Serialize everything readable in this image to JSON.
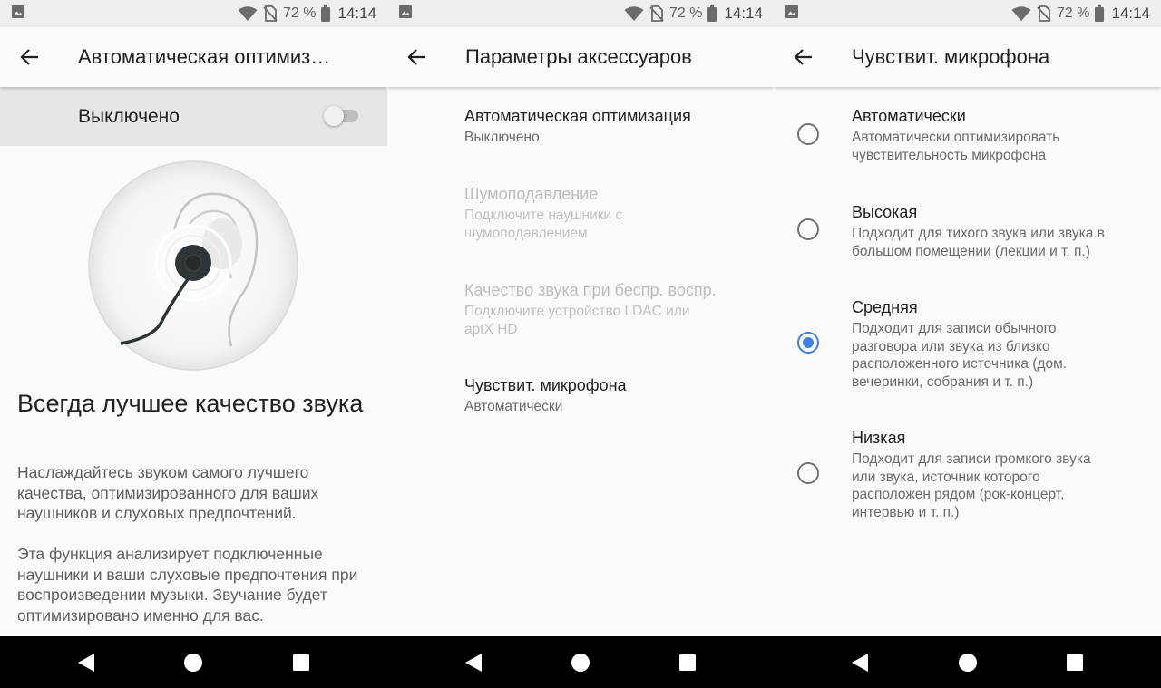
{
  "statusbar": {
    "battery": "72 %",
    "time": "14:14"
  },
  "screen1": {
    "title": "Автоматическая оптимиз…",
    "toggle_label": "Выключено",
    "toggle_on": false,
    "headline": "Всегда лучшее качество звука",
    "para1": "Наслаждайтесь звуком самого лучшего качества, оптимизированного для ваших наушников и слуховых предпочтений.",
    "para2": "Эта функция анализирует подключенные наушники и ваши слуховые предпочтения при воспроизведении музыки. Звучание будет оптимизировано именно для вас."
  },
  "screen2": {
    "title": "Параметры аксессуаров",
    "items": [
      {
        "title": "Автоматическая оптимизация",
        "summary": "Выключено",
        "enabled": true
      },
      {
        "title": "Шумоподавление",
        "summary": "Подключите наушники с шумоподавлением",
        "enabled": false
      },
      {
        "title": "Качество звука при беспр. воспр.",
        "summary": "Подключите устройство LDAC или aptX HD",
        "enabled": false
      },
      {
        "title": "Чувствит. микрофона",
        "summary": "Автоматически",
        "enabled": true
      }
    ]
  },
  "screen3": {
    "title": "Чувствит. микрофона",
    "options": [
      {
        "title": "Автоматически",
        "summary": "Автоматически оптимизировать чувствительность микрофона",
        "checked": false
      },
      {
        "title": "Высокая",
        "summary": "Подходит для тихого звука или звука в большом помещении (лекции и т. п.)",
        "checked": false
      },
      {
        "title": "Средняя",
        "summary": "Подходит для записи обычного разговора или звука из близко расположенного источника (дом. вечеринки, собрания и т. п.)",
        "checked": true
      },
      {
        "title": "Низкая",
        "summary": "Подходит для записи громкого звука или звука, источник которого расположен рядом (рок-концерт, интервью и т. п.)",
        "checked": false
      }
    ]
  },
  "icons": {
    "status": [
      "image-icon",
      "wifi-icon",
      "no-sim-icon",
      "battery-icon"
    ],
    "nav": [
      "back-icon",
      "home-icon",
      "recents-icon"
    ]
  },
  "colors": {
    "accent": "#3f7fe6",
    "background": "#fafafa",
    "toggle_row": "#e6e6e6"
  }
}
